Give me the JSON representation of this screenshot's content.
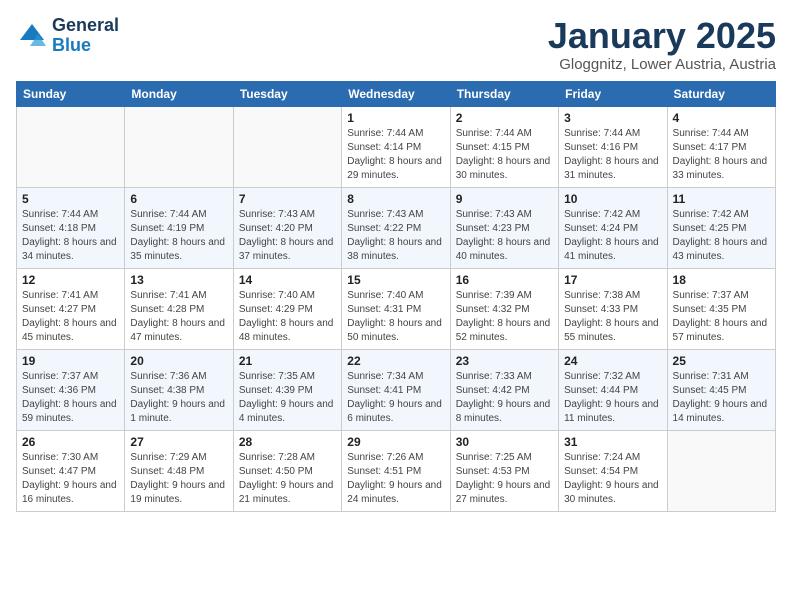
{
  "logo": {
    "general": "General",
    "blue": "Blue"
  },
  "header": {
    "month": "January 2025",
    "location": "Gloggnitz, Lower Austria, Austria"
  },
  "weekdays": [
    "Sunday",
    "Monday",
    "Tuesday",
    "Wednesday",
    "Thursday",
    "Friday",
    "Saturday"
  ],
  "weeks": [
    [
      {
        "num": "",
        "info": ""
      },
      {
        "num": "",
        "info": ""
      },
      {
        "num": "",
        "info": ""
      },
      {
        "num": "1",
        "info": "Sunrise: 7:44 AM\nSunset: 4:14 PM\nDaylight: 8 hours and 29 minutes."
      },
      {
        "num": "2",
        "info": "Sunrise: 7:44 AM\nSunset: 4:15 PM\nDaylight: 8 hours and 30 minutes."
      },
      {
        "num": "3",
        "info": "Sunrise: 7:44 AM\nSunset: 4:16 PM\nDaylight: 8 hours and 31 minutes."
      },
      {
        "num": "4",
        "info": "Sunrise: 7:44 AM\nSunset: 4:17 PM\nDaylight: 8 hours and 33 minutes."
      }
    ],
    [
      {
        "num": "5",
        "info": "Sunrise: 7:44 AM\nSunset: 4:18 PM\nDaylight: 8 hours and 34 minutes."
      },
      {
        "num": "6",
        "info": "Sunrise: 7:44 AM\nSunset: 4:19 PM\nDaylight: 8 hours and 35 minutes."
      },
      {
        "num": "7",
        "info": "Sunrise: 7:43 AM\nSunset: 4:20 PM\nDaylight: 8 hours and 37 minutes."
      },
      {
        "num": "8",
        "info": "Sunrise: 7:43 AM\nSunset: 4:22 PM\nDaylight: 8 hours and 38 minutes."
      },
      {
        "num": "9",
        "info": "Sunrise: 7:43 AM\nSunset: 4:23 PM\nDaylight: 8 hours and 40 minutes."
      },
      {
        "num": "10",
        "info": "Sunrise: 7:42 AM\nSunset: 4:24 PM\nDaylight: 8 hours and 41 minutes."
      },
      {
        "num": "11",
        "info": "Sunrise: 7:42 AM\nSunset: 4:25 PM\nDaylight: 8 hours and 43 minutes."
      }
    ],
    [
      {
        "num": "12",
        "info": "Sunrise: 7:41 AM\nSunset: 4:27 PM\nDaylight: 8 hours and 45 minutes."
      },
      {
        "num": "13",
        "info": "Sunrise: 7:41 AM\nSunset: 4:28 PM\nDaylight: 8 hours and 47 minutes."
      },
      {
        "num": "14",
        "info": "Sunrise: 7:40 AM\nSunset: 4:29 PM\nDaylight: 8 hours and 48 minutes."
      },
      {
        "num": "15",
        "info": "Sunrise: 7:40 AM\nSunset: 4:31 PM\nDaylight: 8 hours and 50 minutes."
      },
      {
        "num": "16",
        "info": "Sunrise: 7:39 AM\nSunset: 4:32 PM\nDaylight: 8 hours and 52 minutes."
      },
      {
        "num": "17",
        "info": "Sunrise: 7:38 AM\nSunset: 4:33 PM\nDaylight: 8 hours and 55 minutes."
      },
      {
        "num": "18",
        "info": "Sunrise: 7:37 AM\nSunset: 4:35 PM\nDaylight: 8 hours and 57 minutes."
      }
    ],
    [
      {
        "num": "19",
        "info": "Sunrise: 7:37 AM\nSunset: 4:36 PM\nDaylight: 8 hours and 59 minutes."
      },
      {
        "num": "20",
        "info": "Sunrise: 7:36 AM\nSunset: 4:38 PM\nDaylight: 9 hours and 1 minute."
      },
      {
        "num": "21",
        "info": "Sunrise: 7:35 AM\nSunset: 4:39 PM\nDaylight: 9 hours and 4 minutes."
      },
      {
        "num": "22",
        "info": "Sunrise: 7:34 AM\nSunset: 4:41 PM\nDaylight: 9 hours and 6 minutes."
      },
      {
        "num": "23",
        "info": "Sunrise: 7:33 AM\nSunset: 4:42 PM\nDaylight: 9 hours and 8 minutes."
      },
      {
        "num": "24",
        "info": "Sunrise: 7:32 AM\nSunset: 4:44 PM\nDaylight: 9 hours and 11 minutes."
      },
      {
        "num": "25",
        "info": "Sunrise: 7:31 AM\nSunset: 4:45 PM\nDaylight: 9 hours and 14 minutes."
      }
    ],
    [
      {
        "num": "26",
        "info": "Sunrise: 7:30 AM\nSunset: 4:47 PM\nDaylight: 9 hours and 16 minutes."
      },
      {
        "num": "27",
        "info": "Sunrise: 7:29 AM\nSunset: 4:48 PM\nDaylight: 9 hours and 19 minutes."
      },
      {
        "num": "28",
        "info": "Sunrise: 7:28 AM\nSunset: 4:50 PM\nDaylight: 9 hours and 21 minutes."
      },
      {
        "num": "29",
        "info": "Sunrise: 7:26 AM\nSunset: 4:51 PM\nDaylight: 9 hours and 24 minutes."
      },
      {
        "num": "30",
        "info": "Sunrise: 7:25 AM\nSunset: 4:53 PM\nDaylight: 9 hours and 27 minutes."
      },
      {
        "num": "31",
        "info": "Sunrise: 7:24 AM\nSunset: 4:54 PM\nDaylight: 9 hours and 30 minutes."
      },
      {
        "num": "",
        "info": ""
      }
    ]
  ]
}
